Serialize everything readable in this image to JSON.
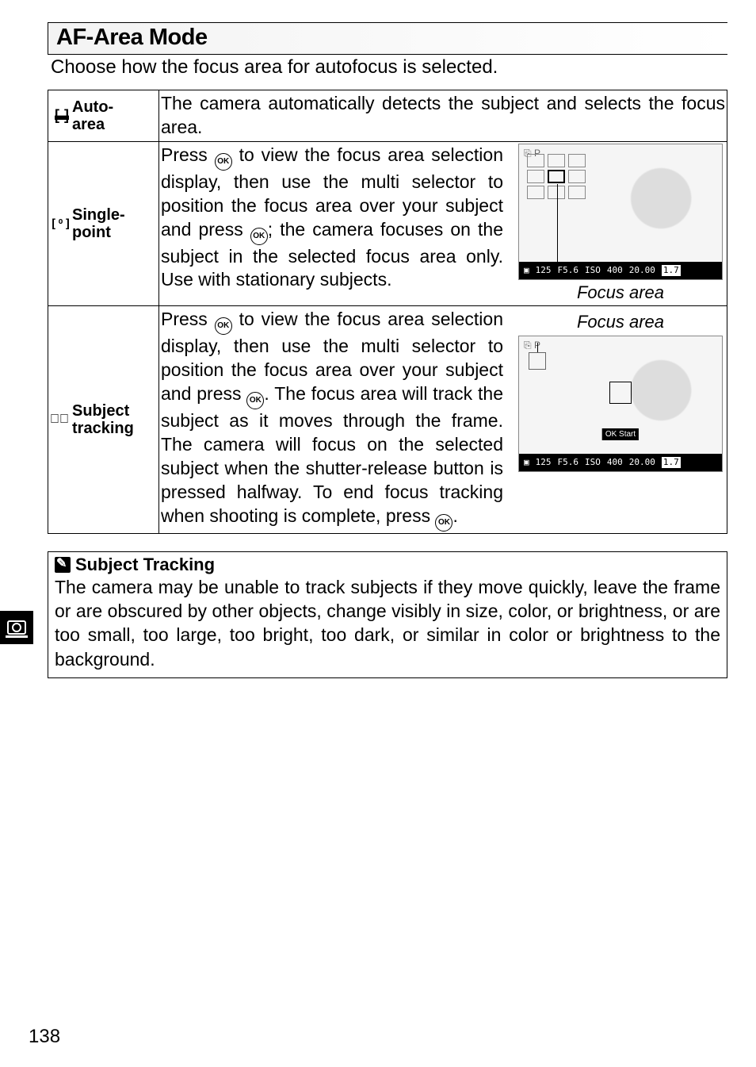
{
  "section_title": "AF-Area Mode",
  "intro": "Choose how the focus area for autofocus is selected.",
  "modes": [
    {
      "icon": "auto-area-icon",
      "glyph": "▭",
      "name_l1": "Auto-",
      "name_l2": "area",
      "text": "The camera automatically detects the subject and selects the focus area."
    },
    {
      "icon": "single-point-icon",
      "glyph": "[ ֯ ]",
      "name_l1": "Single-",
      "name_l2": "point",
      "text_parts": {
        "p1": "Press ",
        "p2": " to view the focus area selection display, then use the multi selector to position the focus area over your subject and press ",
        "p3": "; the camera focuses on the subject in the selected focus area only. Use with stationary subjects."
      },
      "thumb_label": "Focus area",
      "status": {
        "shutter": "125",
        "aperture": "F5.6",
        "iso": "400",
        "remaining": "20.00",
        "zoom": "1.7"
      }
    },
    {
      "icon": "subject-tracking-icon",
      "glyph": "⊕",
      "name_l1": "Subject",
      "name_l2": "tracking",
      "text_parts": {
        "p1": "Press ",
        "p2": " to view the focus area selection display, then use the multi selector to position the focus area over your subject and press ",
        "p3": ". The focus area will track the subject as it moves through the frame. The camera will focus on the selected subject when the shutter-release button is pressed halfway. To end focus tracking when shooting is complete, press ",
        "p4": "."
      },
      "thumb_label": "Focus area",
      "ok_start": "OK Start",
      "status": {
        "shutter": "125",
        "aperture": "F5.6",
        "iso": "400",
        "remaining": "20.00",
        "zoom": "1.7"
      }
    }
  ],
  "ok_label": "OK",
  "note": {
    "title": "Subject Tracking",
    "body": "The camera may be unable to track subjects if they move quickly, leave the frame or are obscured by other objects, change visibly in size, color, or brightness, or are too small, too large, too bright, too dark, or similar in color or brightness to the background."
  },
  "side_tab_glyph": "◘",
  "page_number": "138",
  "thumb_topright": {
    "auto": "⎘",
    "mode": "P"
  }
}
